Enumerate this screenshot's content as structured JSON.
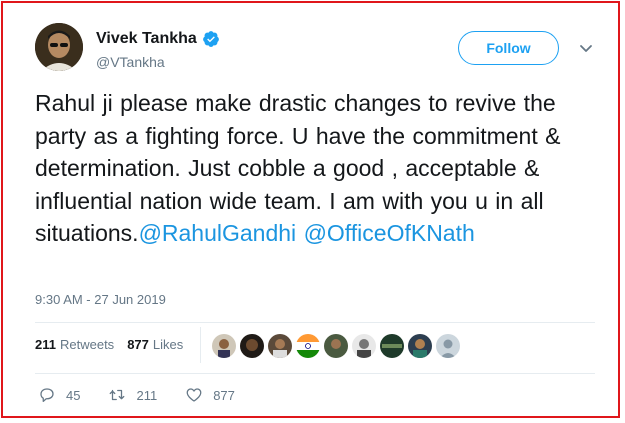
{
  "user": {
    "name": "Vivek Tankha",
    "handle": "@VTankha",
    "verified": true
  },
  "follow_label": "Follow",
  "tweet": {
    "text": "Rahul ji please make drastic changes to revive the party as a fighting force. U have the commitment & determination. Just cobble a good , acceptable & influential nation wide team. I am with you u in all situations.",
    "mention_1": "@RahulGandhi",
    "mention_2": "@OfficeOfKNath"
  },
  "timestamp": "9:30 AM - 27 Jun 2019",
  "stats": {
    "retweets_count": "211",
    "retweets_label": "Retweets",
    "likes_count": "877",
    "likes_label": "Likes"
  },
  "actions": {
    "replies": "45",
    "retweets": "211",
    "likes": "877"
  },
  "colors": {
    "accent": "#1da1f2",
    "mention": "#1b95e0",
    "frame": "#e0161b"
  },
  "icons": [
    "verified-badge-icon",
    "chevron-down-icon",
    "reply-icon",
    "retweet-icon",
    "like-icon"
  ]
}
